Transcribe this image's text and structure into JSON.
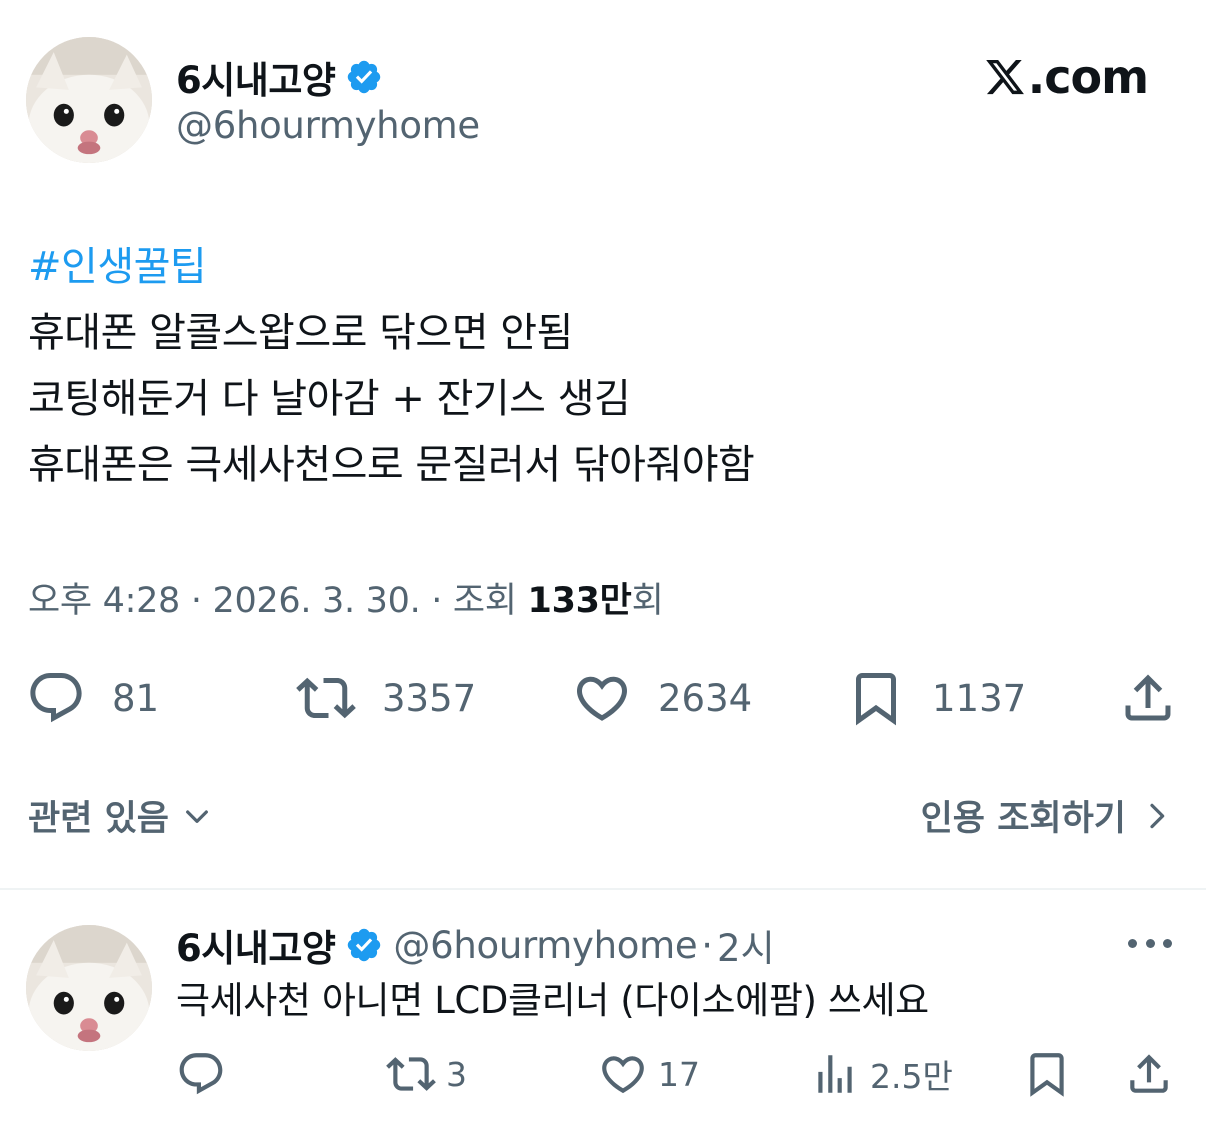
{
  "tweet": {
    "display_name": "6시내고양",
    "handle": "@6hourmyhome",
    "hashtag": "#인생꿀팁",
    "lines": [
      "휴대폰 알콜스왑으로 닦으면 안됨",
      "코팅해둔거 다 날아감 + 잔기스 생김",
      "휴대폰은 극세사천으로 문질러서 닦아줘야함"
    ],
    "meta_prefix": "오후 4:28 · 2026. 3. 30. · 조회 ",
    "views_count": "133만",
    "views_suffix": "회"
  },
  "brand": {
    "label": ".com"
  },
  "actions": {
    "replies": "81",
    "retweets": "3357",
    "likes": "2634",
    "bookmarks": "1137"
  },
  "links": {
    "related": "관련 있음",
    "quotes": "인용 조회하기"
  },
  "reply": {
    "display_name": "6시내고양",
    "handle": "@6hourmyhome",
    "separator": "·",
    "time": "2시",
    "text": "극세사천 아니면 LCD클리너 (다이소에팜) 쓰세요",
    "retweets": "3",
    "likes": "17",
    "views": "2.5만"
  },
  "colors": {
    "accent": "#1d9bf0",
    "text": "#0f1419",
    "secondary": "#536471",
    "divider": "#eff3f4"
  },
  "icons": {
    "verified": "verified-badge-icon",
    "reply": "speech-bubble-icon",
    "retweet": "retweet-arrows-icon",
    "like": "heart-icon",
    "bookmark": "bookmark-icon",
    "share": "share-upload-icon",
    "views": "bar-chart-icon",
    "more": "more-dots-icon",
    "chevron_down": "chevron-down-icon",
    "chevron_right": "chevron-right-icon"
  }
}
